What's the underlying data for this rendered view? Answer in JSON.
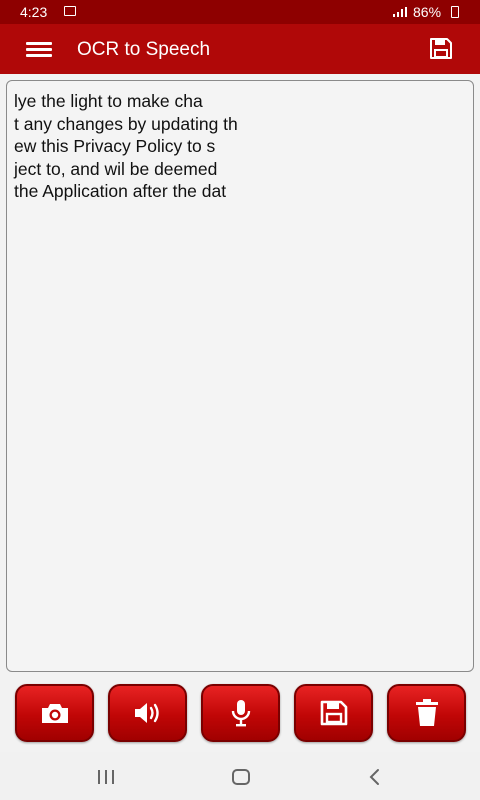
{
  "status_bar": {
    "time": "4:23",
    "battery_percent": "86%",
    "icons": [
      "gallery-icon",
      "signal-icon",
      "battery-icon"
    ]
  },
  "app_bar": {
    "title": "OCR to Speech",
    "icons": [
      "menu-icon",
      "save-icon"
    ]
  },
  "text_area": {
    "value": "lye the light to make cha\nt any changes by updating th\new this Privacy Policy to s\nject to, and wil be deemed\nthe Application after the dat"
  },
  "toolbar": {
    "buttons": [
      {
        "icon": "camera-icon"
      },
      {
        "icon": "speaker-icon"
      },
      {
        "icon": "microphone-icon"
      },
      {
        "icon": "save-icon"
      },
      {
        "icon": "trash-icon"
      }
    ]
  },
  "nav_bar": {
    "icons": [
      "recent-apps-icon",
      "home-icon",
      "back-icon"
    ]
  },
  "colors": {
    "status_bar": "#8e0000",
    "app_bar": "#b00808",
    "button_red": "#d00a0a",
    "background": "#f2f2f2"
  }
}
